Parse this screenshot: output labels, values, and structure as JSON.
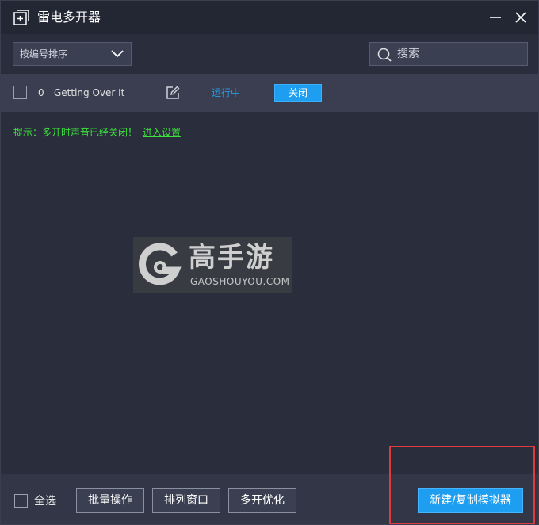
{
  "window": {
    "title": "雷电多开器",
    "minimize_label": "minimize",
    "close_label": "close"
  },
  "toolbar": {
    "sort_selected": "按编号排序",
    "search_placeholder": "搜索"
  },
  "list": {
    "rows": [
      {
        "index": "0",
        "name": "Getting Over It",
        "status": "运行中",
        "action": "关闭"
      }
    ]
  },
  "tip": {
    "text": "提示：多开时声音已经关闭！",
    "link": "进入设置"
  },
  "watermark": {
    "cn": "高手游",
    "en": "GAOSHOUYOU.COM"
  },
  "bottom": {
    "select_all": "全选",
    "batch": "批量操作",
    "arrange": "排列窗口",
    "optimize": "多开优化",
    "new_copy": "新建/复制模拟器"
  },
  "colors": {
    "accent": "#1e9ef0",
    "status_running": "#2a9ae0",
    "tip_green": "#3ce03c",
    "highlight": "#e03a3a"
  }
}
